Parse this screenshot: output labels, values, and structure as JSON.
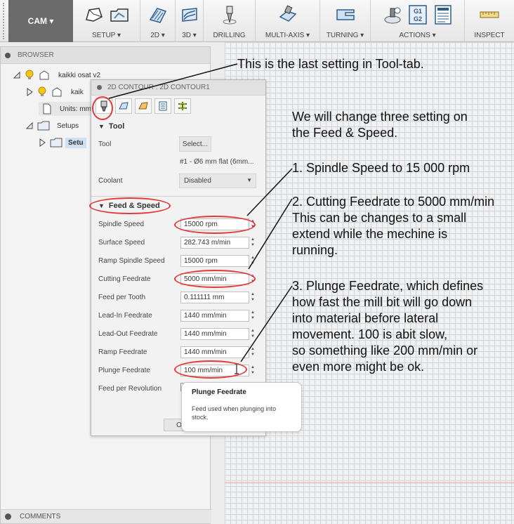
{
  "toolbar": {
    "workspace_label": "CAM ▾",
    "groups": [
      {
        "label": "SETUP ▾"
      },
      {
        "label": "2D ▾"
      },
      {
        "label": "3D ▾"
      },
      {
        "label": "DRILLING"
      },
      {
        "label": "MULTI-AXIS ▾"
      },
      {
        "label": "TURNING ▾"
      },
      {
        "label": "ACTIONS ▾"
      },
      {
        "label": "INSPECT"
      }
    ],
    "actions_icon_text_1": "G1",
    "actions_icon_text_2": "G2"
  },
  "browser": {
    "title": "BROWSER",
    "items": [
      {
        "label": "kaikki osat v2"
      },
      {
        "label": "kaik"
      },
      {
        "label": "Units: mm"
      },
      {
        "label": "Setups"
      },
      {
        "label": "Setu"
      }
    ],
    "comments_label": "COMMENTS"
  },
  "dialog": {
    "title": "2D CONTOUR : 2D CONTOUR1",
    "tool_section": "Tool",
    "tool_label": "Tool",
    "select_button": "Select...",
    "tool_description": "#1 - Ø6 mm flat (6mm...",
    "coolant_label": "Coolant",
    "coolant_value": "Disabled",
    "feed_section": "Feed & Speed",
    "fields": [
      {
        "label": "Spindle Speed",
        "value": "15000 rpm"
      },
      {
        "label": "Surface Speed",
        "value": "282.743 m/min"
      },
      {
        "label": "Ramp Spindle Speed",
        "value": "15000 rpm"
      },
      {
        "label": "Cutting Feedrate",
        "value": "5000 mm/min"
      },
      {
        "label": "Feed per Tooth",
        "value": "0.111111 mm"
      },
      {
        "label": "Lead-In Feedrate",
        "value": "1440 mm/min"
      },
      {
        "label": "Lead-Out Feedrate",
        "value": "1440 mm/min"
      },
      {
        "label": "Ramp Feedrate",
        "value": "1440 mm/min"
      },
      {
        "label": "Plunge Feedrate",
        "value": "100 mm/min"
      }
    ],
    "feed_per_rev_label": "Feed per Revolution",
    "ok_button": "O"
  },
  "tooltip": {
    "title": "Plunge Feedrate",
    "body": "Feed used when plunging into\nstock."
  },
  "annotations": {
    "top_note": "This is the last setting in Tool-tab.",
    "intro": "We will change three setting on\nthe Feed & Speed.",
    "step1": "1. Spindle Speed to 15 000 rpm",
    "step2": "2. Cutting Feedrate to 5000 mm/min\nThis can be changes to a small\nextend while the mechine is\nrunning.",
    "step3": "3. Plunge Feedrate, which defines\nhow fast the mill bit will go down\ninto material before lateral\nmovement. 100 is abit slow,\nso something like 200 mm/min or\neven more might be ok."
  },
  "colors": {
    "annotation_red": "#e23b3b",
    "cam_button": "#6b6b6b",
    "grid_line": "#cfd4da"
  }
}
